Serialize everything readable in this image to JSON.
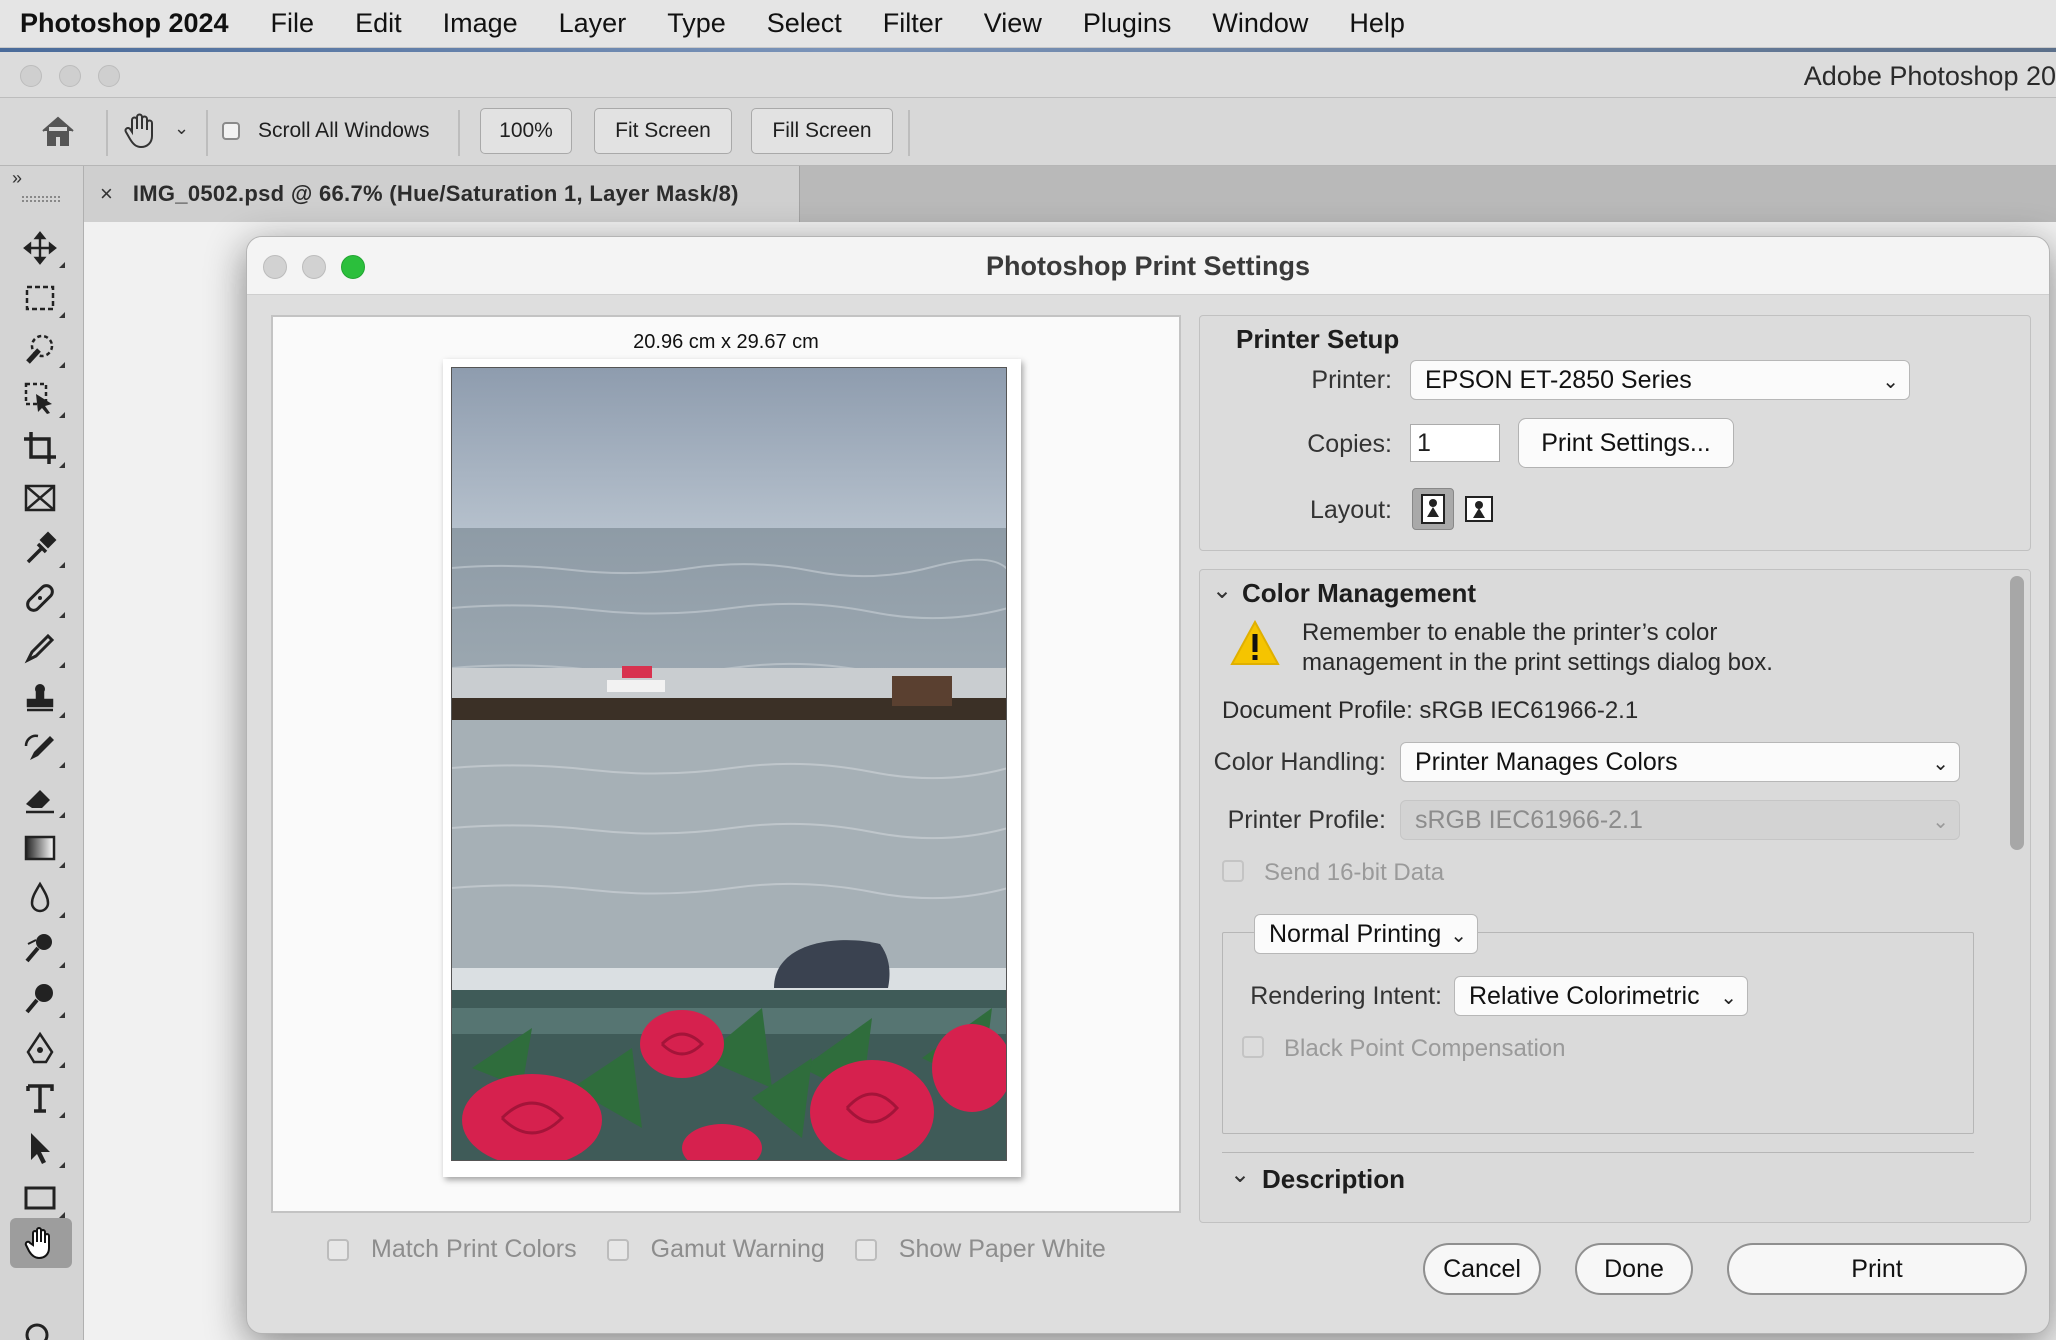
{
  "menubar": {
    "app_name": "Photoshop 2024",
    "items": [
      "File",
      "Edit",
      "Image",
      "Layer",
      "Type",
      "Select",
      "Filter",
      "View",
      "Plugins",
      "Window",
      "Help"
    ]
  },
  "window": {
    "title": "Adobe Photoshop 20"
  },
  "options_bar": {
    "scroll_all_label": "Scroll All Windows",
    "zoom_label": "100%",
    "fit_screen_label": "Fit Screen",
    "fill_screen_label": "Fill Screen"
  },
  "tools": [
    "move-tool-icon",
    "marquee-tool-icon",
    "quick-select-tool-icon",
    "object-select-tool-icon",
    "crop-tool-icon",
    "frame-tool-icon",
    "eyedropper-tool-icon",
    "healing-brush-icon",
    "brush-tool-icon",
    "clone-stamp-icon",
    "history-brush-icon",
    "eraser-tool-icon",
    "gradient-tool-icon",
    "blur-tool-icon",
    "dodge-tool-icon",
    "sponge-tool-icon",
    "pen-tool-icon",
    "type-tool-icon",
    "path-select-icon",
    "rectangle-tool-icon",
    "hand-tool-icon",
    "zoom-tool-icon"
  ],
  "document_tab": {
    "close_glyph": "×",
    "title": "IMG_0502.psd @ 66.7% (Hue/Saturation 1, Layer Mask/8)"
  },
  "dialog": {
    "title": "Photoshop Print Settings",
    "preview": {
      "paper_size": "20.96 cm x 29.67 cm"
    },
    "bottom_checks": [
      "Match Print Colors",
      "Gamut Warning",
      "Show Paper White"
    ],
    "printer_setup": {
      "title": "Printer Setup",
      "printer_label": "Printer:",
      "printer_value": "EPSON ET-2850 Series",
      "copies_label": "Copies:",
      "copies_value": "1",
      "print_settings_label": "Print Settings...",
      "layout_label": "Layout:"
    },
    "color_management": {
      "title": "Color Management",
      "warning_line1": "Remember to enable the printer’s color",
      "warning_line2": "management in the print settings dialog box.",
      "document_profile": "Document Profile: sRGB IEC61966-2.1",
      "color_handling_label": "Color Handling:",
      "color_handling_value": "Printer Manages Colors",
      "printer_profile_label": "Printer Profile:",
      "printer_profile_value": "sRGB IEC61966-2.1",
      "send16_label": "Send 16-bit Data",
      "printing_mode": "Normal Printing",
      "rendering_intent_label": "Rendering Intent:",
      "rendering_intent_value": "Relative Colorimetric",
      "black_point_label": "Black Point Compensation"
    },
    "description": {
      "title": "Description"
    },
    "buttons": {
      "cancel": "Cancel",
      "done": "Done",
      "print": "Print"
    }
  },
  "colors": {
    "accent_green": "#2bbf3c",
    "warning_yellow": "#f5c400"
  }
}
